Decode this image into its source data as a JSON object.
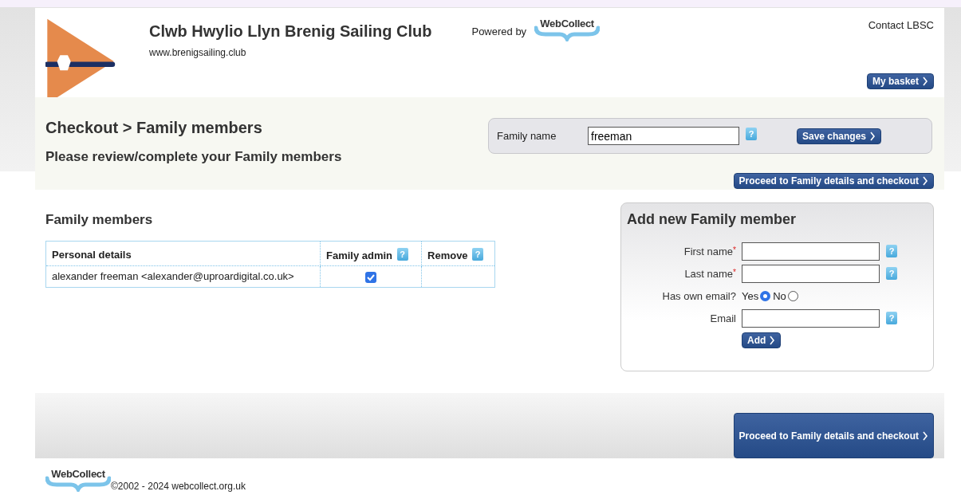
{
  "header": {
    "club_name": "Clwb Hwylio Llyn Brenig Sailing Club",
    "website": "www.brenigsailing.club",
    "powered_by": "Powered by",
    "powered_logo": "WebCollect",
    "contact_link": "Contact LBSC",
    "basket_button": "My basket"
  },
  "checkout": {
    "breadcrumb": "Checkout > Family members",
    "subtitle": "Please review/complete your Family members",
    "family_name": {
      "label": "Family name",
      "value": "freeman",
      "help": "?"
    },
    "save_button": "Save changes",
    "proceed_button": "Proceed to Family details and checkout"
  },
  "members": {
    "title": "Family members",
    "table": {
      "columns": [
        {
          "label": "Personal details"
        },
        {
          "label": "Family admin",
          "help": "?"
        },
        {
          "label": "Remove",
          "help": "?"
        }
      ],
      "rows": [
        {
          "personal_details": "alexander freeman <alexander@uproardigital.co.uk>",
          "family_admin": true
        }
      ]
    }
  },
  "add_member": {
    "title": "Add new Family member",
    "fields": [
      {
        "kind": "text",
        "label": "First name",
        "required_mark": "*",
        "help": "?"
      },
      {
        "kind": "text",
        "label": "Last name",
        "required_mark": "*",
        "help": "?"
      },
      {
        "kind": "radio",
        "label": "Has own email?",
        "options": [
          {
            "label": "Yes",
            "selected": true
          },
          {
            "label": "No",
            "selected": false
          }
        ]
      },
      {
        "kind": "text",
        "label": "Email",
        "help": "?"
      }
    ],
    "add_button": "Add"
  },
  "footer_bar": {
    "proceed_button": "Proceed to Family details and checkout"
  },
  "footer": {
    "logo": "WebCollect",
    "copyright": "©2002 - 2024 webcollect.org.uk"
  }
}
